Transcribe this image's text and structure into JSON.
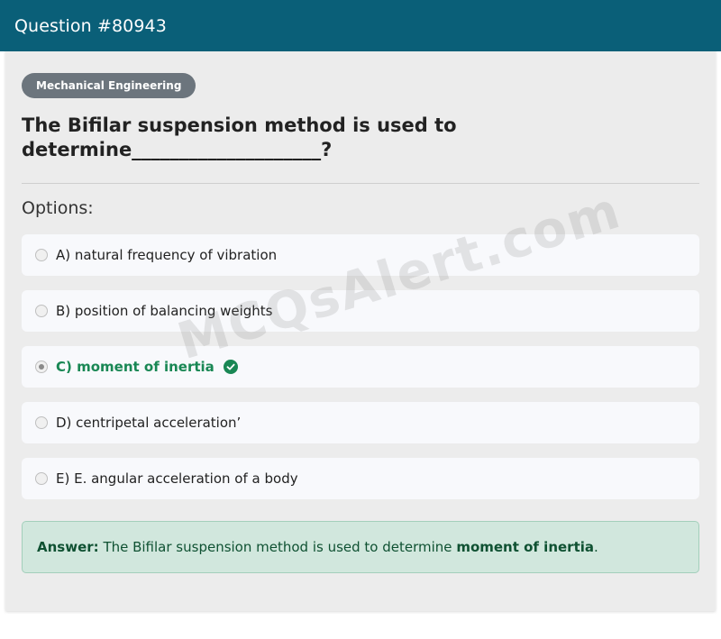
{
  "header": {
    "title": "Question #80943"
  },
  "category": "Mechanical Engineering",
  "question_text": "The Bifilar suspension method is used to determine____________________?",
  "options_heading": "Options:",
  "options": [
    {
      "label": "A) natural frequency of vibration",
      "selected": false,
      "correct": false
    },
    {
      "label": "B) position of balancing weights",
      "selected": false,
      "correct": false
    },
    {
      "label": "C) moment of inertia",
      "selected": true,
      "correct": true
    },
    {
      "label": "D) centripetal acceleration’",
      "selected": false,
      "correct": false
    },
    {
      "label": "E) E. angular acceleration of a body",
      "selected": false,
      "correct": false
    }
  ],
  "answer": {
    "prefix": "Answer:",
    "text": "The Bifilar suspension method is used to determine",
    "highlight": "moment of inertia",
    "suffix": "."
  },
  "watermark": "MCQsAlert.com",
  "colors": {
    "header": "#0a5f78",
    "badge": "#6c757d",
    "correct": "#198754",
    "answer_bg": "#d1e7dd"
  },
  "icons": {
    "correct_option": "check-circle-icon"
  }
}
